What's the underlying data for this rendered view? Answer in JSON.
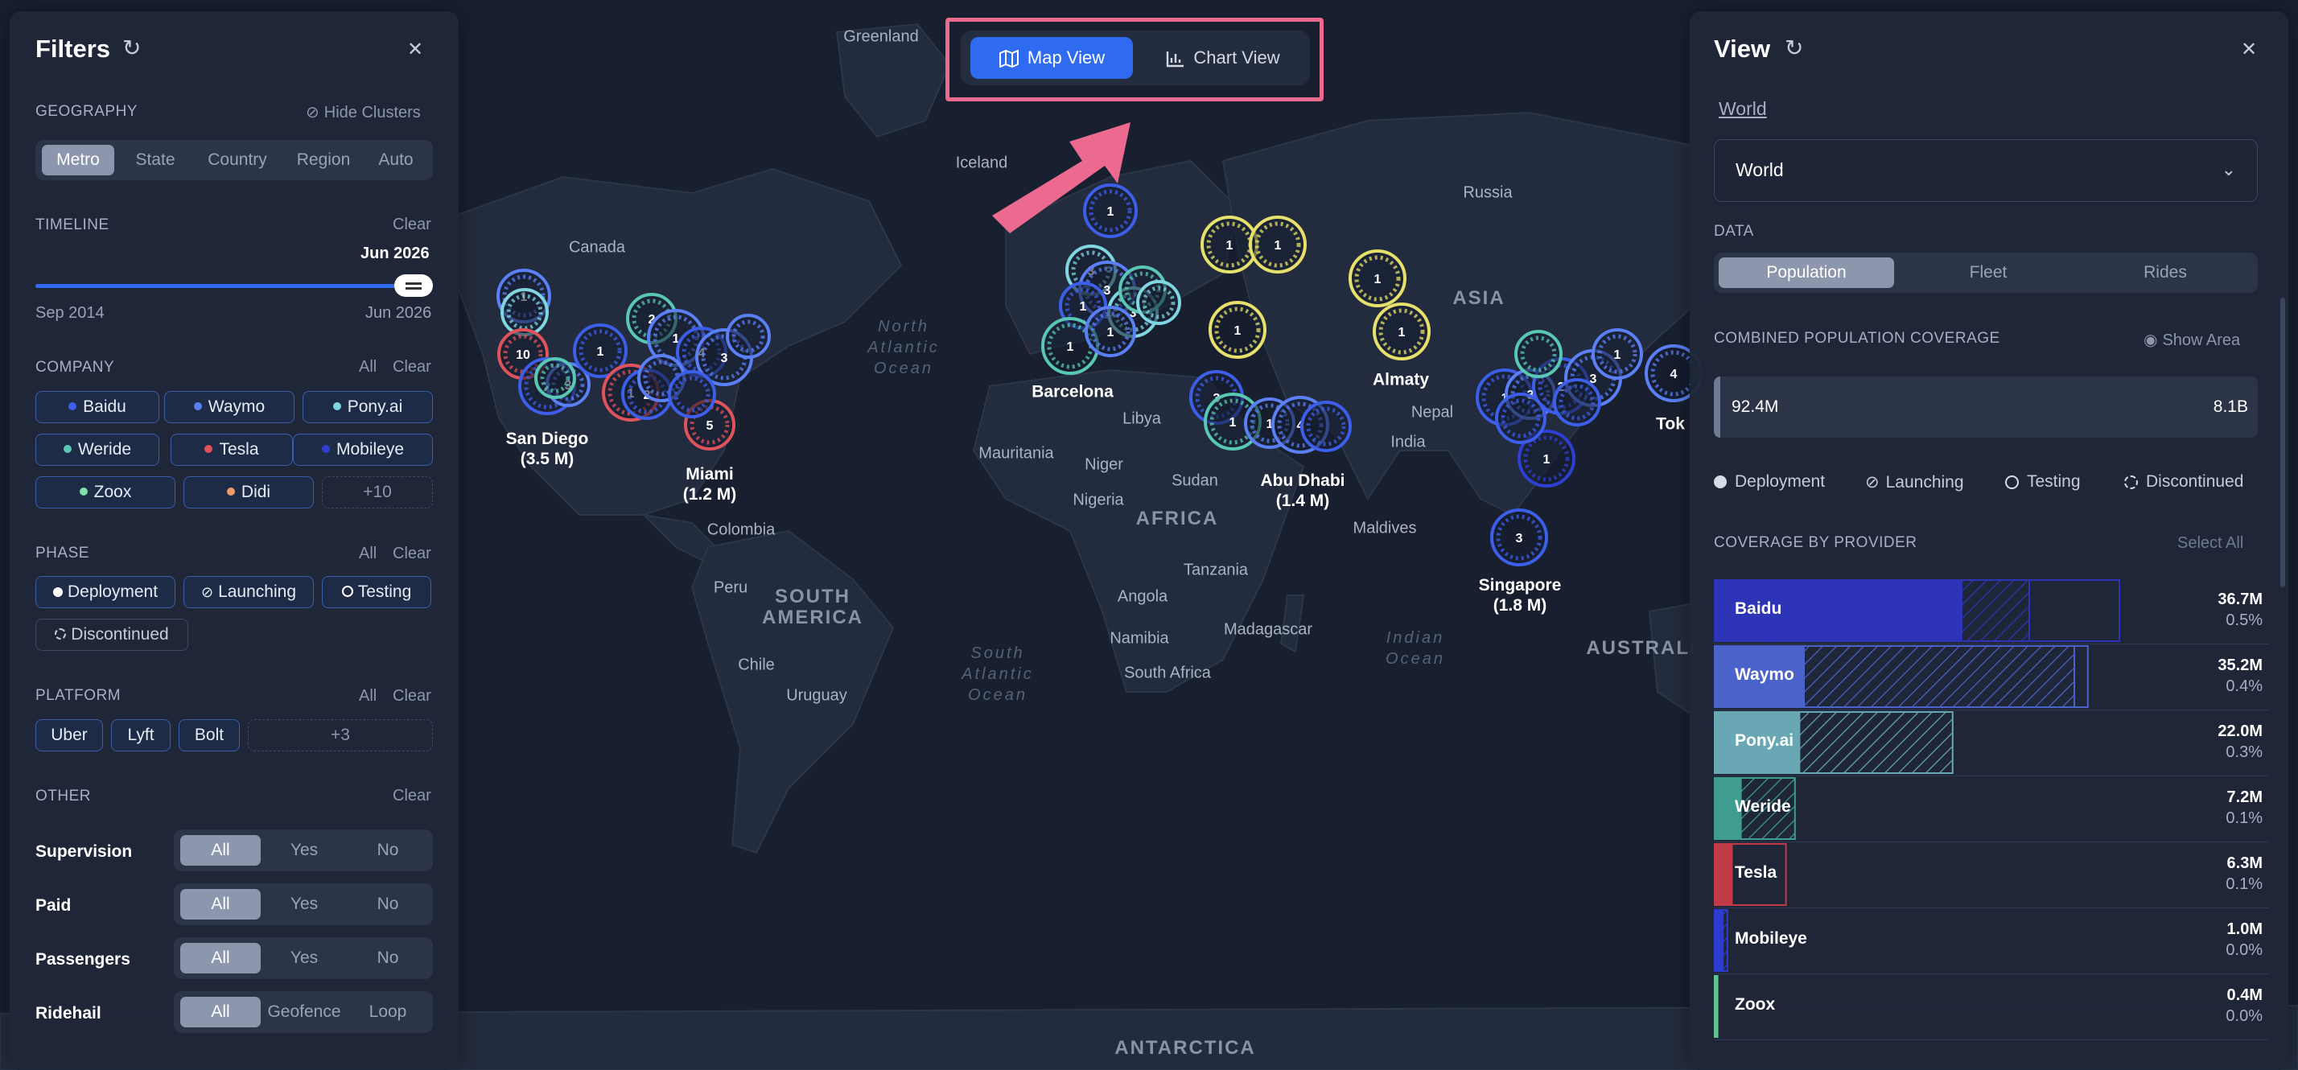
{
  "toggle": {
    "map_label": "Map View",
    "chart_label": "Chart View",
    "active": "map"
  },
  "filters": {
    "title": "Filters",
    "geography": {
      "label": "GEOGRAPHY",
      "hide_clusters": "Hide Clusters",
      "options": [
        "Metro",
        "State",
        "Country",
        "Region",
        "Auto"
      ],
      "selected": "Metro"
    },
    "timeline": {
      "label": "TIMELINE",
      "clear": "Clear",
      "current": "Jun 2026",
      "start": "Sep 2014",
      "end": "Jun 2026",
      "position_fraction": 1.0
    },
    "company": {
      "label": "COMPANY",
      "all": "All",
      "clear": "Clear",
      "items": [
        {
          "name": "Baidu",
          "color": "#3d5ee8"
        },
        {
          "name": "Waymo",
          "color": "#5b7ff5"
        },
        {
          "name": "Pony.ai",
          "color": "#7fd6e0"
        },
        {
          "name": "Weride",
          "color": "#58c7b3"
        },
        {
          "name": "Tesla",
          "color": "#e0535a"
        },
        {
          "name": "Mobileye",
          "color": "#2f3fd1"
        },
        {
          "name": "Zoox",
          "color": "#7ee0a8"
        },
        {
          "name": "Didi",
          "color": "#f09a6a"
        }
      ],
      "more": "+10"
    },
    "phase": {
      "label": "PHASE",
      "all": "All",
      "clear": "Clear",
      "items": [
        "Deployment",
        "Launching",
        "Testing",
        "Discontinued"
      ]
    },
    "platform": {
      "label": "PLATFORM",
      "all": "All",
      "clear": "Clear",
      "items": [
        "Uber",
        "Lyft",
        "Bolt"
      ],
      "more": "+3"
    },
    "other": {
      "label": "OTHER",
      "clear": "Clear",
      "rows": [
        {
          "label": "Supervision",
          "options": [
            "All",
            "Yes",
            "No"
          ],
          "selected": "All"
        },
        {
          "label": "Paid",
          "options": [
            "All",
            "Yes",
            "No"
          ],
          "selected": "All"
        },
        {
          "label": "Passengers",
          "options": [
            "All",
            "Yes",
            "No"
          ],
          "selected": "All"
        },
        {
          "label": "Ridehail",
          "options": [
            "All",
            "Geofence",
            "Loop"
          ],
          "selected": "All"
        }
      ]
    }
  },
  "view": {
    "title": "View",
    "breadcrumb": "World",
    "dropdown_value": "World",
    "data_label": "DATA",
    "data_tabs": [
      "Population",
      "Fleet",
      "Rides"
    ],
    "data_selected": "Population",
    "coverage_label": "COMBINED POPULATION COVERAGE",
    "show_area": "Show Area",
    "coverage_value": "92.4M",
    "coverage_total": "8.1B",
    "coverage_fraction": 0.0114,
    "legend": [
      "Deployment",
      "Launching",
      "Testing",
      "Discontinued"
    ],
    "providers_label": "COVERAGE BY PROVIDER",
    "select_all": "Select All",
    "providers": [
      {
        "name": "Baidu",
        "value": "36.7M",
        "percent": "0.5%",
        "color": "#2e34b8",
        "solid": 0.55,
        "hatched": 0.15,
        "outline": 0.2
      },
      {
        "name": "Waymo",
        "value": "35.2M",
        "percent": "0.4%",
        "color": "#4a62c9",
        "solid": 0.2,
        "hatched": 0.6,
        "outline": 0.03
      },
      {
        "name": "Pony.ai",
        "value": "22.0M",
        "percent": "0.3%",
        "color": "#6aa7b4",
        "solid": 0.19,
        "hatched": 0.34,
        "outline": 0.0
      },
      {
        "name": "Weride",
        "value": "7.2M",
        "percent": "0.1%",
        "color": "#3f9c8f",
        "solid": 0.06,
        "hatched": 0.12,
        "outline": 0.0
      },
      {
        "name": "Tesla",
        "value": "6.3M",
        "percent": "0.1%",
        "color": "#c03a48",
        "solid": 0.04,
        "hatched": 0.0,
        "outline": 0.12
      },
      {
        "name": "Mobileye",
        "value": "1.0M",
        "percent": "0.0%",
        "color": "#2c3bd0",
        "solid": 0.02,
        "hatched": 0.01,
        "outline": 0.0
      },
      {
        "name": "Zoox",
        "value": "0.4M",
        "percent": "0.0%",
        "color": "#5fc48d",
        "solid": 0.01,
        "hatched": 0.0,
        "outline": 0.0
      }
    ]
  },
  "map": {
    "countries": [
      "Greenland",
      "Iceland",
      "Canada",
      "Russia",
      "ASIA",
      "Libya",
      "Mauritania",
      "Niger",
      "Sudan",
      "Nigeria",
      "AFRICA",
      "Nepal",
      "India",
      "Maldives",
      "Tanzania",
      "Angola",
      "Namibia",
      "Madagascar",
      "South Africa",
      "Colombia",
      "Peru",
      "SOUTH AMERICA",
      "Chile",
      "Uruguay",
      "AUSTRALI",
      "ANTARCTICA"
    ],
    "oceans": [
      "North Atlantic Ocean",
      "South Atlantic Ocean",
      "Indian Ocean"
    ],
    "cities": [
      {
        "name": "San Diego",
        "sub": "(3.5 M)"
      },
      {
        "name": "Miami",
        "sub": "(1.2 M)"
      },
      {
        "name": "Barcelona",
        "sub": ""
      },
      {
        "name": "Almaty",
        "sub": ""
      },
      {
        "name": "Abu Dhabi",
        "sub": "(1.4 M)"
      },
      {
        "name": "Singapore",
        "sub": "(1.8 M)"
      },
      {
        "name": "Tok",
        "sub": ""
      }
    ],
    "cluster_counts": [
      "1",
      "2",
      "3",
      "4",
      "5",
      "10"
    ]
  },
  "colors": {
    "accent": "#2f6bf0",
    "highlight": "#ec6a8f",
    "panel": "#1e2638",
    "map": "#1a2233"
  }
}
